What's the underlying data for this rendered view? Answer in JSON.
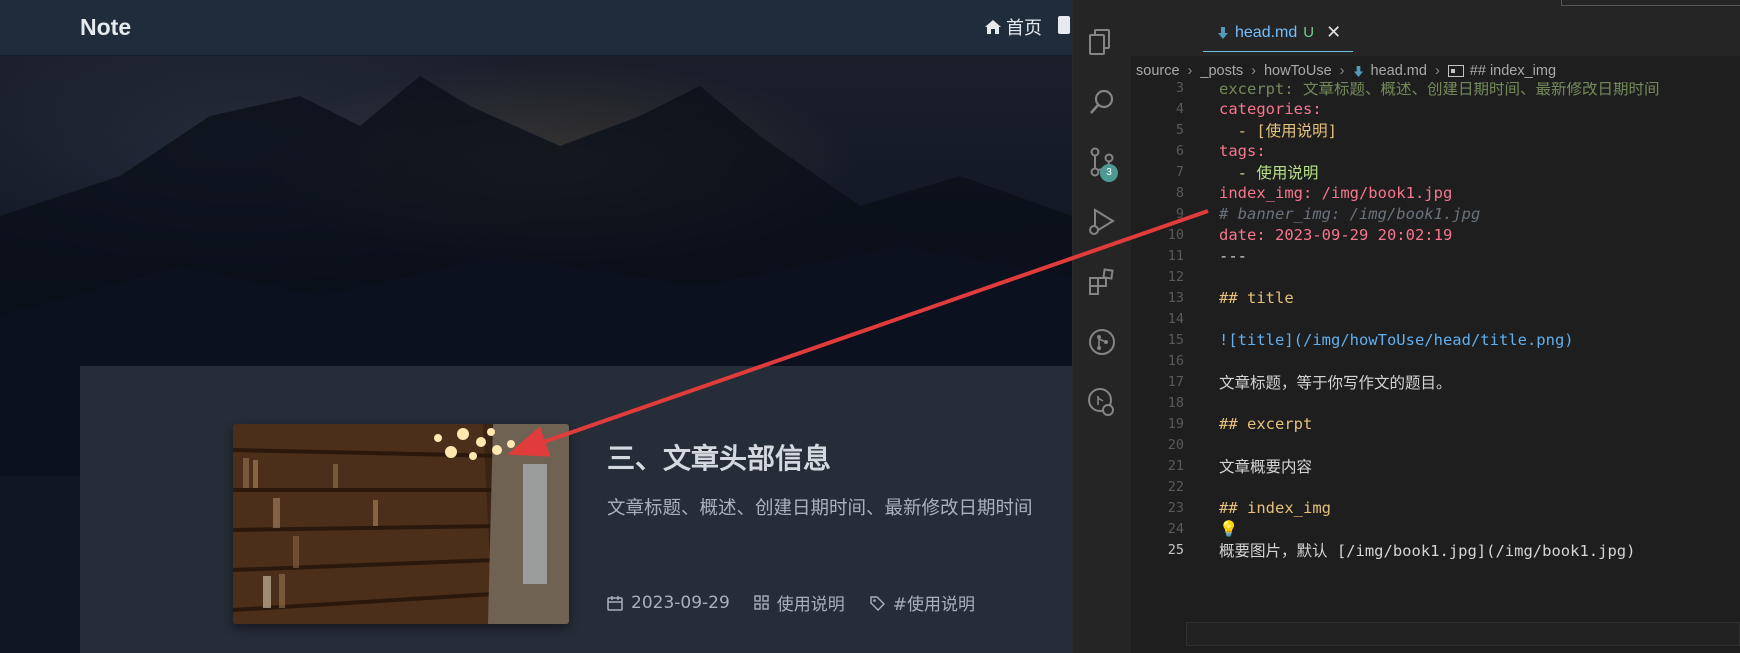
{
  "blog": {
    "brand": "Note",
    "nav_home": "首页",
    "post": {
      "title": "三、文章头部信息",
      "excerpt": "文章标题、概述、创建日期时间、最新修改日期时间",
      "date": "2023-09-29",
      "category": "使用说明",
      "tag": "#使用说明"
    }
  },
  "vscode": {
    "tab": {
      "file": "head.md",
      "flag": "U",
      "close": "✕"
    },
    "git_badge": "3",
    "breadcrumb": [
      "source",
      "_posts",
      "howToUse",
      "head.md",
      "## index_img"
    ],
    "lines": [
      {
        "n": "3",
        "text": "excerpt: 文章标题、概述、创建日期时间、最新修改日期时间"
      },
      {
        "n": "4",
        "text": "categories:"
      },
      {
        "n": "5",
        "text": "  - [使用说明]"
      },
      {
        "n": "6",
        "text": "tags:"
      },
      {
        "n": "7",
        "text": "  - 使用说明"
      },
      {
        "n": "8",
        "text": "index_img: /img/book1.jpg"
      },
      {
        "n": "9",
        "text": "# banner_img: /img/book1.jpg"
      },
      {
        "n": "10",
        "text": "date: 2023-09-29 20:02:19"
      },
      {
        "n": "11",
        "text": "---"
      },
      {
        "n": "12",
        "text": ""
      },
      {
        "n": "13",
        "text": "## title"
      },
      {
        "n": "14",
        "text": ""
      },
      {
        "n": "15",
        "text": "![title](/img/howToUse/head/title.png)"
      },
      {
        "n": "16",
        "text": ""
      },
      {
        "n": "17",
        "text": "文章标题，等于你写作文的题目。"
      },
      {
        "n": "18",
        "text": ""
      },
      {
        "n": "19",
        "text": "## excerpt"
      },
      {
        "n": "20",
        "text": ""
      },
      {
        "n": "21",
        "text": "文章概要内容"
      },
      {
        "n": "22",
        "text": ""
      },
      {
        "n": "23",
        "text": "## index_img"
      },
      {
        "n": "24",
        "text": "💡"
      },
      {
        "n": "25",
        "text": "概要图片，默认 [/img/book1.jpg](/img/book1.jpg)"
      }
    ]
  },
  "colors": {
    "accent_line": "#e23b3b",
    "tab_underline": "#6fc3df"
  }
}
